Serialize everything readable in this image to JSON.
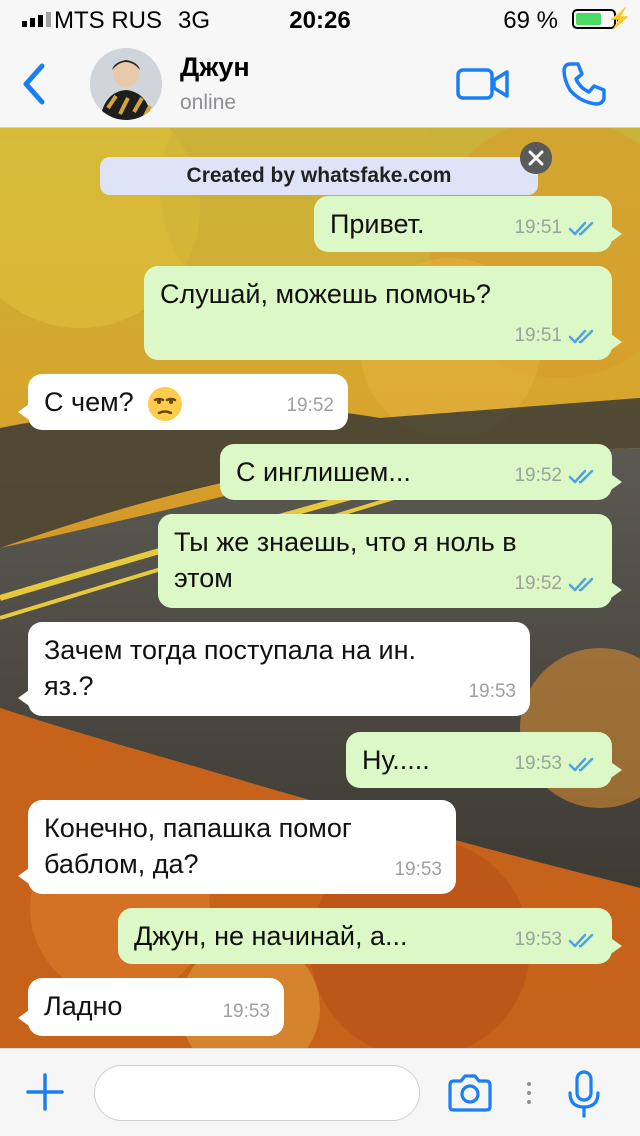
{
  "status_bar": {
    "carrier": "MTS RUS",
    "network": "3G",
    "time": "20:26",
    "battery_percent": "69 %",
    "battery_level": 0.69,
    "battery_color": "#4cd964"
  },
  "header": {
    "contact_name": "Джун",
    "contact_status": "online",
    "accent_color": "#1a7ef5"
  },
  "watermark": {
    "text": "Created by whatsfake.com"
  },
  "messages": [
    {
      "direction": "out",
      "text": "Привет.",
      "time": "19:51",
      "read": true
    },
    {
      "direction": "out",
      "text": "Слушай, можешь помочь?",
      "time": "19:51",
      "read": true
    },
    {
      "direction": "in",
      "text": "С чем?",
      "emoji": "unamused-face-emoji",
      "time": "19:52"
    },
    {
      "direction": "out",
      "text": "С инглишем...",
      "time": "19:52",
      "read": true
    },
    {
      "direction": "out",
      "text": "Ты же знаешь, что я ноль в этом",
      "time": "19:52",
      "read": true
    },
    {
      "direction": "in",
      "text": "Зачем тогда поступала на ин. яз.?",
      "time": "19:53"
    },
    {
      "direction": "out",
      "text": "Ну.....",
      "time": "19:53",
      "read": true
    },
    {
      "direction": "in",
      "text": "Конечно, папашка помог баблом, да?",
      "time": "19:53"
    },
    {
      "direction": "out",
      "text": "Джун, не начинай, а...",
      "time": "19:53",
      "read": true
    },
    {
      "direction": "in",
      "text": "Ладно",
      "time": "19:53"
    }
  ],
  "input_bar": {
    "placeholder": "",
    "icons": [
      "plus-icon",
      "camera-icon",
      "more-dots-icon",
      "microphone-icon"
    ]
  },
  "colors": {
    "outgoing_bubble": "#dcf8c6",
    "incoming_bubble": "#ffffff",
    "read_ticks": "#4fa3e0"
  }
}
